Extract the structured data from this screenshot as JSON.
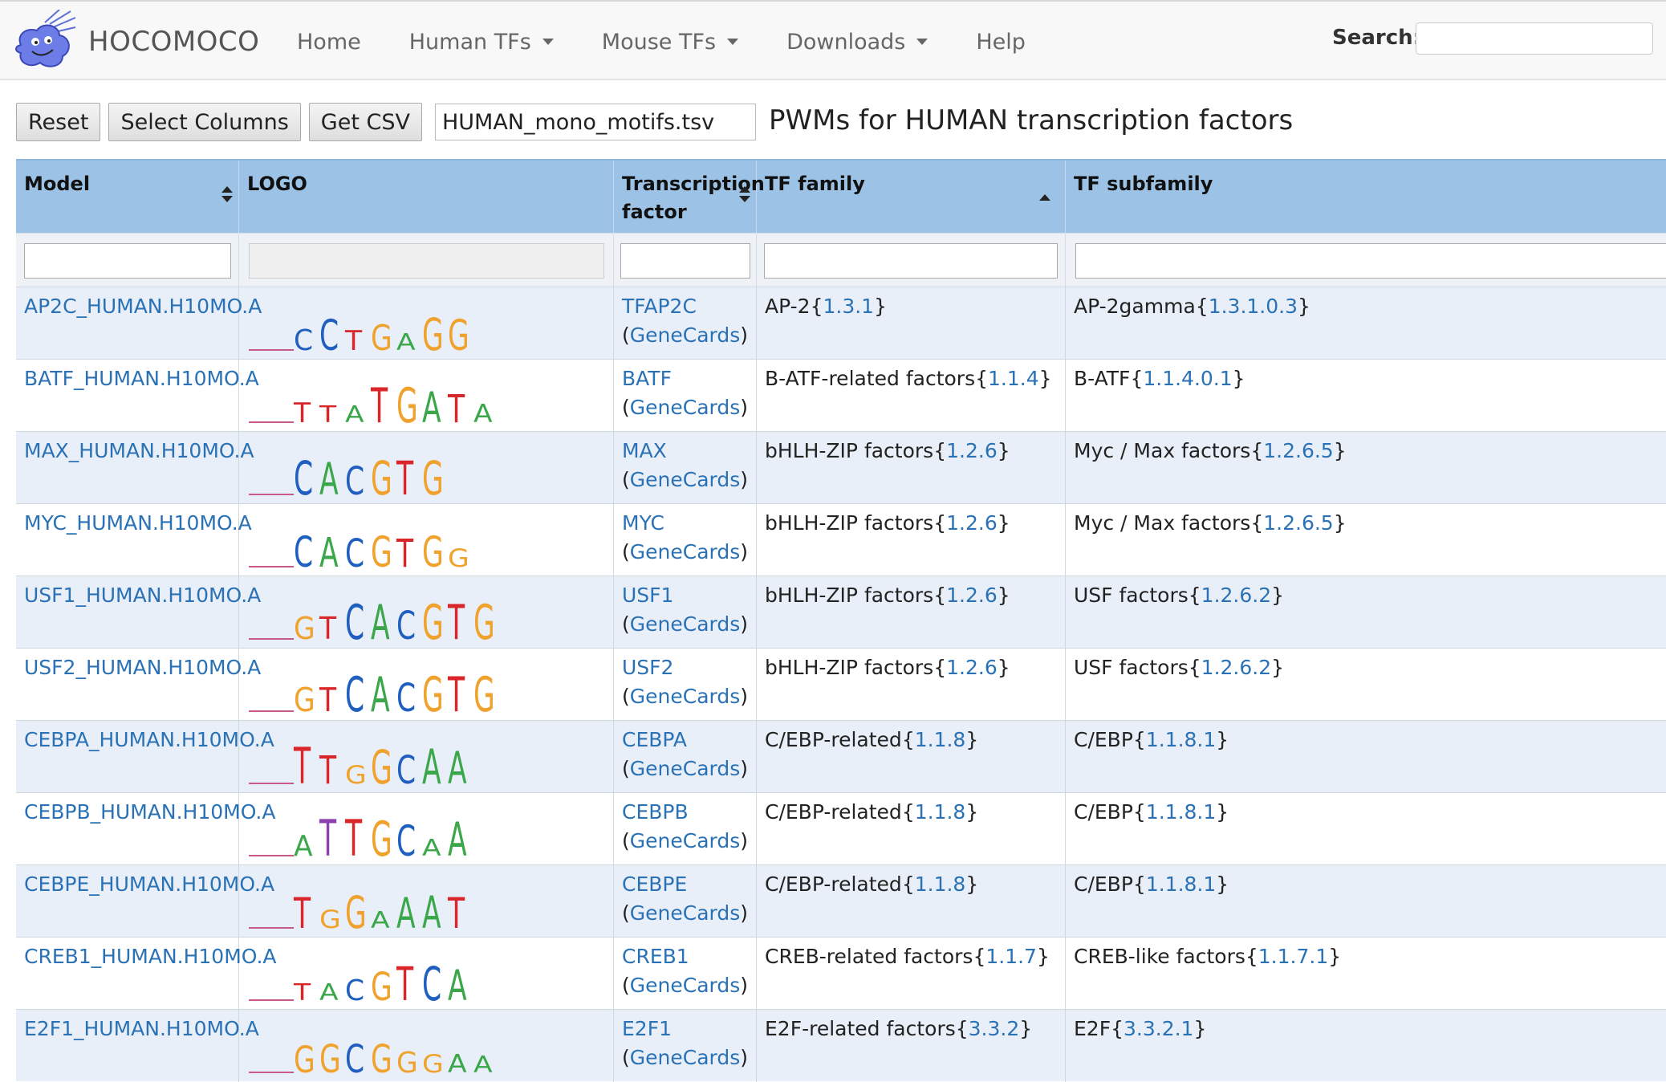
{
  "nav": {
    "brand": "HOCOMOCO",
    "items": [
      {
        "label": "Home",
        "dropdown": false
      },
      {
        "label": "Human TFs",
        "dropdown": true
      },
      {
        "label": "Mouse TFs",
        "dropdown": true
      },
      {
        "label": "Downloads",
        "dropdown": true
      },
      {
        "label": "Help",
        "dropdown": false
      }
    ],
    "search_label": "Search:",
    "search_value": ""
  },
  "toolbar": {
    "reset_label": "Reset",
    "select_columns_label": "Select Columns",
    "get_csv_label": "Get CSV",
    "filename_value": "HUMAN_mono_motifs.tsv"
  },
  "page_title": "PWMs for HUMAN transcription factors",
  "table": {
    "headers": {
      "model": "Model",
      "logo": "LOGO",
      "tf_line1": "Transcription",
      "tf_line2": "factor",
      "family": "TF family",
      "subfamily": "TF subfamily"
    },
    "genecards_label": "GeneCards",
    "rows": [
      {
        "model": "AP2C_HUMAN.H10MO.A",
        "tf": "TFAP2C",
        "family": "AP-2",
        "family_id": "1.3.1",
        "subfamily": "AP-2gamma",
        "subfamily_id": "1.3.1.0.3",
        "logo": [
          {
            "t": "C",
            "c": "#1f5fbf",
            "h": 0.35
          },
          {
            "t": "C",
            "c": "#1f5fbf",
            "h": 0.7
          },
          {
            "t": "T",
            "c": "#d9262b",
            "h": 0.3
          },
          {
            "t": "G",
            "c": "#f0a22e",
            "h": 0.5
          },
          {
            "t": "A",
            "c": "#3aa84a",
            "h": 0.2
          },
          {
            "t": "G",
            "c": "#f0a22e",
            "h": 0.75
          },
          {
            "t": "G",
            "c": "#f0a22e",
            "h": 0.7
          }
        ]
      },
      {
        "model": "BATF_HUMAN.H10MO.A",
        "tf": "BATF",
        "family": "B-ATF-related factors",
        "family_id": "1.1.4",
        "subfamily": "B-ATF",
        "subfamily_id": "1.1.4.0.1",
        "logo": [
          {
            "t": "T",
            "c": "#d9262b",
            "h": 0.3
          },
          {
            "t": "T",
            "c": "#d9262b",
            "h": 0.2
          },
          {
            "t": "A",
            "c": "#3aa84a",
            "h": 0.2
          },
          {
            "t": "T",
            "c": "#d9262b",
            "h": 0.85
          },
          {
            "t": "G",
            "c": "#f0a22e",
            "h": 0.85
          },
          {
            "t": "A",
            "c": "#3aa84a",
            "h": 0.7
          },
          {
            "t": "T",
            "c": "#d9262b",
            "h": 0.6
          },
          {
            "t": "A",
            "c": "#3aa84a",
            "h": 0.25
          }
        ]
      },
      {
        "model": "MAX_HUMAN.H10MO.A",
        "tf": "MAX",
        "family": "bHLH-ZIP factors",
        "family_id": "1.2.6",
        "subfamily": "Myc / Max factors",
        "subfamily_id": "1.2.6.5",
        "logo": [
          {
            "t": "C",
            "c": "#1f5fbf",
            "h": 0.8
          },
          {
            "t": "A",
            "c": "#3aa84a",
            "h": 0.75
          },
          {
            "t": "C",
            "c": "#1f5fbf",
            "h": 0.6
          },
          {
            "t": "G",
            "c": "#f0a22e",
            "h": 0.8
          },
          {
            "t": "T",
            "c": "#d9262b",
            "h": 0.8
          },
          {
            "t": "G",
            "c": "#f0a22e",
            "h": 0.8
          }
        ]
      },
      {
        "model": "MYC_HUMAN.H10MO.A",
        "tf": "MYC",
        "family": "bHLH-ZIP factors",
        "family_id": "1.2.6",
        "subfamily": "Myc / Max factors",
        "subfamily_id": "1.2.6.5",
        "logo": [
          {
            "t": "C",
            "c": "#1f5fbf",
            "h": 0.7
          },
          {
            "t": "A",
            "c": "#3aa84a",
            "h": 0.65
          },
          {
            "t": "C",
            "c": "#1f5fbf",
            "h": 0.6
          },
          {
            "t": "G",
            "c": "#f0a22e",
            "h": 0.7
          },
          {
            "t": "T",
            "c": "#d9262b",
            "h": 0.6
          },
          {
            "t": "G",
            "c": "#f0a22e",
            "h": 0.7
          },
          {
            "t": "G",
            "c": "#f0a22e",
            "h": 0.25
          }
        ]
      },
      {
        "model": "USF1_HUMAN.H10MO.A",
        "tf": "USF1",
        "family": "bHLH-ZIP factors",
        "family_id": "1.2.6",
        "subfamily": "USF factors",
        "subfamily_id": "1.2.6.2",
        "logo": [
          {
            "t": "G",
            "c": "#f0a22e",
            "h": 0.4
          },
          {
            "t": "T",
            "c": "#d9262b",
            "h": 0.4
          },
          {
            "t": "C",
            "c": "#1f5fbf",
            "h": 0.85
          },
          {
            "t": "A",
            "c": "#3aa84a",
            "h": 0.85
          },
          {
            "t": "C",
            "c": "#1f5fbf",
            "h": 0.6
          },
          {
            "t": "G",
            "c": "#f0a22e",
            "h": 0.85
          },
          {
            "t": "T",
            "c": "#d9262b",
            "h": 0.85
          },
          {
            "t": "G",
            "c": "#f0a22e",
            "h": 0.85
          }
        ]
      },
      {
        "model": "USF2_HUMAN.H10MO.A",
        "tf": "USF2",
        "family": "bHLH-ZIP factors",
        "family_id": "1.2.6",
        "subfamily": "USF factors",
        "subfamily_id": "1.2.6.2",
        "logo": [
          {
            "t": "G",
            "c": "#f0a22e",
            "h": 0.45
          },
          {
            "t": "T",
            "c": "#d9262b",
            "h": 0.45
          },
          {
            "t": "C",
            "c": "#1f5fbf",
            "h": 0.85
          },
          {
            "t": "A",
            "c": "#3aa84a",
            "h": 0.85
          },
          {
            "t": "C",
            "c": "#1f5fbf",
            "h": 0.6
          },
          {
            "t": "G",
            "c": "#f0a22e",
            "h": 0.85
          },
          {
            "t": "T",
            "c": "#d9262b",
            "h": 0.85
          },
          {
            "t": "G",
            "c": "#f0a22e",
            "h": 0.85
          }
        ]
      },
      {
        "model": "CEBPA_HUMAN.H10MO.A",
        "tf": "CEBPA",
        "family": "C/EBP-related",
        "family_id": "1.1.8",
        "subfamily": "C/EBP",
        "subfamily_id": "1.1.8.1",
        "logo": [
          {
            "t": "T",
            "c": "#d9262b",
            "h": 0.9
          },
          {
            "t": "T",
            "c": "#d9262b",
            "h": 0.6
          },
          {
            "t": "G",
            "c": "#f0a22e",
            "h": 0.25
          },
          {
            "t": "G",
            "c": "#f0a22e",
            "h": 0.8
          },
          {
            "t": "C",
            "c": "#1f5fbf",
            "h": 0.6
          },
          {
            "t": "A",
            "c": "#3aa84a",
            "h": 0.85
          },
          {
            "t": "A",
            "c": "#3aa84a",
            "h": 0.75
          }
        ]
      },
      {
        "model": "CEBPB_HUMAN.H10MO.A",
        "tf": "CEBPB",
        "family": "C/EBP-related",
        "family_id": "1.1.8",
        "subfamily": "C/EBP",
        "subfamily_id": "1.1.8.1",
        "logo": [
          {
            "t": "A",
            "c": "#3aa84a",
            "h": 0.35
          },
          {
            "t": "T",
            "c": "#8b3fb0",
            "h": 0.9
          },
          {
            "t": "T",
            "c": "#d9262b",
            "h": 0.9
          },
          {
            "t": "G",
            "c": "#f0a22e",
            "h": 0.85
          },
          {
            "t": "C",
            "c": "#1f5fbf",
            "h": 0.7
          },
          {
            "t": "A",
            "c": "#3aa84a",
            "h": 0.2
          },
          {
            "t": "A",
            "c": "#3aa84a",
            "h": 0.8
          }
        ]
      },
      {
        "model": "CEBPE_HUMAN.H10MO.A",
        "tf": "CEBPE",
        "family": "C/EBP-related",
        "family_id": "1.1.8",
        "subfamily": "C/EBP",
        "subfamily_id": "1.1.8.1",
        "logo": [
          {
            "t": "T",
            "c": "#d9262b",
            "h": 0.7
          },
          {
            "t": "G",
            "c": "#f0a22e",
            "h": 0.25
          },
          {
            "t": "G",
            "c": "#f0a22e",
            "h": 0.75
          },
          {
            "t": "A",
            "c": "#3aa84a",
            "h": 0.2
          },
          {
            "t": "A",
            "c": "#3aa84a",
            "h": 0.7
          },
          {
            "t": "A",
            "c": "#3aa84a",
            "h": 0.75
          },
          {
            "t": "T",
            "c": "#d9262b",
            "h": 0.7
          }
        ]
      },
      {
        "model": "CREB1_HUMAN.H10MO.A",
        "tf": "CREB1",
        "family": "CREB-related factors",
        "family_id": "1.1.7",
        "subfamily": "CREB-like factors",
        "subfamily_id": "1.1.7.1",
        "logo": [
          {
            "t": "T",
            "c": "#d9262b",
            "h": 0.2
          },
          {
            "t": "A",
            "c": "#3aa84a",
            "h": 0.2
          },
          {
            "t": "C",
            "c": "#1f5fbf",
            "h": 0.35
          },
          {
            "t": "G",
            "c": "#f0a22e",
            "h": 0.6
          },
          {
            "t": "T",
            "c": "#d9262b",
            "h": 0.8
          },
          {
            "t": "C",
            "c": "#1f5fbf",
            "h": 0.8
          },
          {
            "t": "A",
            "c": "#3aa84a",
            "h": 0.7
          }
        ]
      },
      {
        "model": "E2F1_HUMAN.H10MO.A",
        "tf": "E2F1",
        "family": "E2F-related factors",
        "family_id": "3.3.2",
        "subfamily": "E2F",
        "subfamily_id": "3.3.2.1",
        "logo": [
          {
            "t": "G",
            "c": "#f0a22e",
            "h": 0.55
          },
          {
            "t": "G",
            "c": "#f0a22e",
            "h": 0.6
          },
          {
            "t": "C",
            "c": "#1f5fbf",
            "h": 0.6
          },
          {
            "t": "G",
            "c": "#f0a22e",
            "h": 0.6
          },
          {
            "t": "G",
            "c": "#f0a22e",
            "h": 0.35
          },
          {
            "t": "G",
            "c": "#f0a22e",
            "h": 0.25
          },
          {
            "t": "A",
            "c": "#3aa84a",
            "h": 0.25
          },
          {
            "t": "A",
            "c": "#3aa84a",
            "h": 0.2
          }
        ]
      }
    ]
  }
}
